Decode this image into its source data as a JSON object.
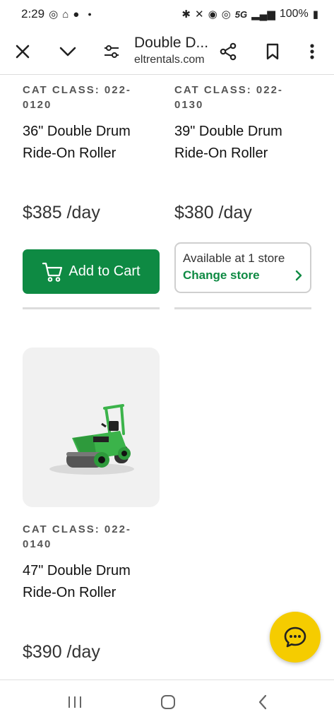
{
  "status_bar": {
    "time": "2:29",
    "battery": "100%",
    "network": "5G"
  },
  "toolbar": {
    "title": "Double D...",
    "url": "eltrentals.com"
  },
  "products": [
    {
      "cat_class": "CAT CLASS: 022-0120",
      "cat_line1": "CAT CLASS: 022-",
      "cat_line2": "0120",
      "name_line1": "36\" Double Drum",
      "name_line2": "Ride-On Roller",
      "price": "$385 /day",
      "action": "Add to Cart"
    },
    {
      "cat_class": "CAT CLASS: 022-0130",
      "cat_line1": "CAT CLASS: 022-",
      "cat_line2": "0130",
      "name_line1": "39\" Double Drum",
      "name_line2": "Ride-On Roller",
      "price": "$380 /day",
      "availability": "Available at 1 store",
      "change_store": "Change store"
    },
    {
      "cat_class": "CAT CLASS: 022-0140",
      "cat_line1": "CAT CLASS: 022-",
      "cat_line2": "0140",
      "name_line1": "47\" Double Drum",
      "name_line2": "Ride-On Roller",
      "price": "$390 /day"
    }
  ],
  "colors": {
    "brand_green": "#0e8a43",
    "chat_yellow": "#f5cc00"
  },
  "icons": {
    "close": "close-icon",
    "chevron": "chevron-down-icon",
    "tune": "tune-icon",
    "share": "share-icon",
    "bookmark": "bookmark-icon",
    "more": "more-vert-icon",
    "cart": "cart-icon",
    "chat": "chat-icon"
  }
}
